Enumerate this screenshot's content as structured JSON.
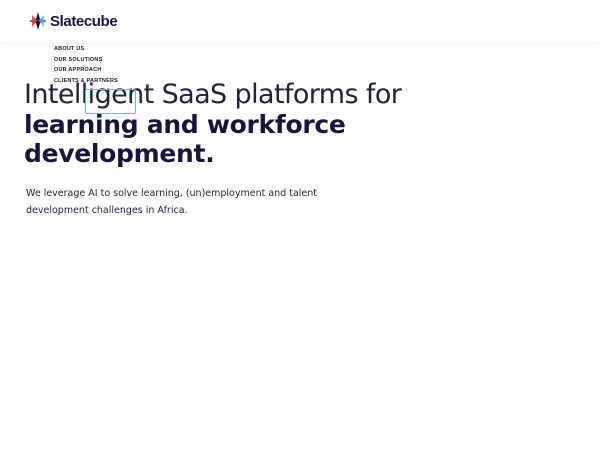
{
  "header": {
    "logo_text": "Slatecube",
    "logo_icon": "slatecube-star-logo-icon"
  },
  "nav": {
    "items": [
      {
        "label": "ABOUT US"
      },
      {
        "label": "OUR SOLUTIONS"
      },
      {
        "label": "OUR APPROACH"
      },
      {
        "label": "CLIENTS & PARTNERS"
      }
    ]
  },
  "hero": {
    "line1": "Intelligent SaaS platforms for",
    "line2": "learning and workforce",
    "line3": "development."
  },
  "subtitle": {
    "line1": "We leverage AI to solve learning, (un)employment and talent",
    "line2": "development challenges in Africa."
  },
  "colors": {
    "brand_dark": "#16163a",
    "accent_teal": "#5cc3d3",
    "accent_red": "#e2454a"
  }
}
